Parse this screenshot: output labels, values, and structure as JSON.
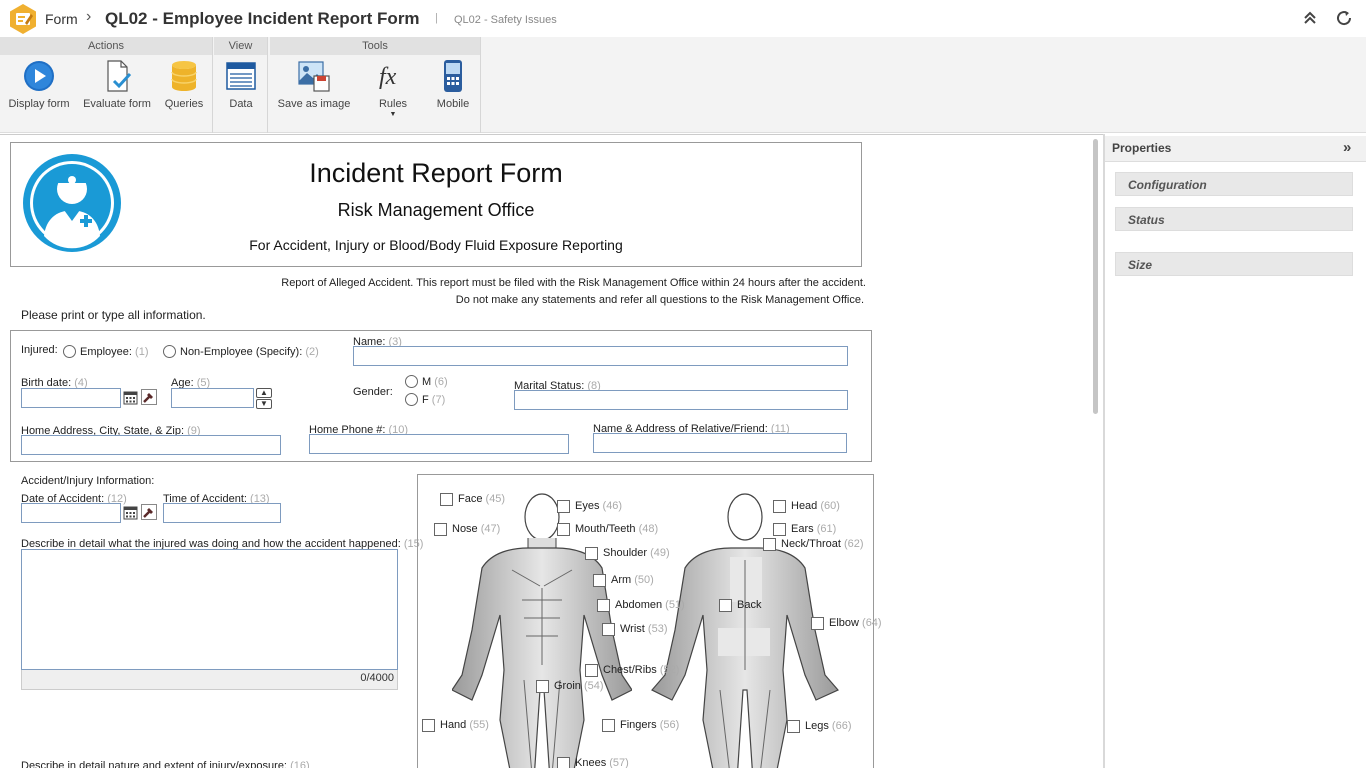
{
  "topbar": {
    "crumb": "Form",
    "title": "QL02 - Employee Incident Report Form",
    "divider": "|",
    "subtitle": "QL02 - Safety Issues"
  },
  "ribbon": {
    "groups": [
      "Actions",
      "View",
      "Tools"
    ],
    "buttons": {
      "display_form": "Display form",
      "evaluate_form": "Evaluate form",
      "queries": "Queries",
      "data": "Data",
      "save_as_image": "Save as image",
      "rules": "Rules",
      "mobile": "Mobile"
    }
  },
  "properties": {
    "title": "Properties",
    "sections": [
      "Configuration",
      "Status",
      "Size"
    ]
  },
  "form": {
    "header": {
      "title": "Incident Report Form",
      "office": "Risk Management Office",
      "purpose": "For Accident, Injury or Blood/Body Fluid Exposure Reporting"
    },
    "notice_line1": "Report of Alleged Accident. This report must be filed with the Risk Management Office within 24 hours after the accident.",
    "notice_line2": "Do not make any statements and refer all questions to the Risk Management Office.",
    "print_note": "Please print or type all information.",
    "fields": {
      "injured": "Injured:",
      "employee": "Employee:",
      "employee_num": "(1)",
      "non_employee": "Non-Employee (Specify):",
      "non_employee_num": "(2)",
      "name": "Name:",
      "name_num": "(3)",
      "birth_date": "Birth date:",
      "birth_date_num": "(4)",
      "age": "Age:",
      "age_num": "(5)",
      "gender": "Gender:",
      "gender_m": "M",
      "gender_m_num": "(6)",
      "gender_f": "F",
      "gender_f_num": "(7)",
      "marital": "Marital Status:",
      "marital_num": "(8)",
      "address": "Home Address, City, State, & Zip:",
      "address_num": "(9)",
      "phone": "Home Phone #:",
      "phone_num": "(10)",
      "relative": "Name & Address of Relative/Friend:",
      "relative_num": "(11)",
      "accident_info": "Accident/Injury Information:",
      "date_acc": "Date of Accident:",
      "date_acc_num": "(12)",
      "time_acc": "Time of Accident:",
      "time_acc_num": "(13)",
      "describe": "Describe in detail what the injured was doing and how the accident happened:",
      "describe_num": "(15)",
      "counter": "0/4000",
      "nature": "Describe in detail nature and extent of injury/exposure:",
      "nature_num": "(16)"
    },
    "body_parts": [
      {
        "label": "Face",
        "num": "(45)"
      },
      {
        "label": "Eyes",
        "num": "(46)"
      },
      {
        "label": "Nose",
        "num": "(47)"
      },
      {
        "label": "Mouth/Teeth",
        "num": "(48)"
      },
      {
        "label": "Shoulder",
        "num": "(49)"
      },
      {
        "label": "Arm",
        "num": "(50)"
      },
      {
        "label": "Abdomen",
        "num": "(51)"
      },
      {
        "label": "Chest/Ribs",
        "num": "(52)"
      },
      {
        "label": "Wrist",
        "num": "(53)"
      },
      {
        "label": "Groin",
        "num": "(54)"
      },
      {
        "label": "Hand",
        "num": "(55)"
      },
      {
        "label": "Fingers",
        "num": "(56)"
      },
      {
        "label": "Knees",
        "num": "(57)"
      },
      {
        "label": "Head",
        "num": "(60)"
      },
      {
        "label": "Ears",
        "num": "(61)"
      },
      {
        "label": "Neck/Throat",
        "num": "(62)"
      },
      {
        "label": "Back",
        "num": ""
      },
      {
        "label": "Elbow",
        "num": "(64)"
      },
      {
        "label": "Legs",
        "num": "(66)"
      }
    ]
  },
  "colors": {
    "accent": "#1a9ad6",
    "brand_logo": "#f0b030",
    "ribbon_bg": "#f3f3f3"
  }
}
